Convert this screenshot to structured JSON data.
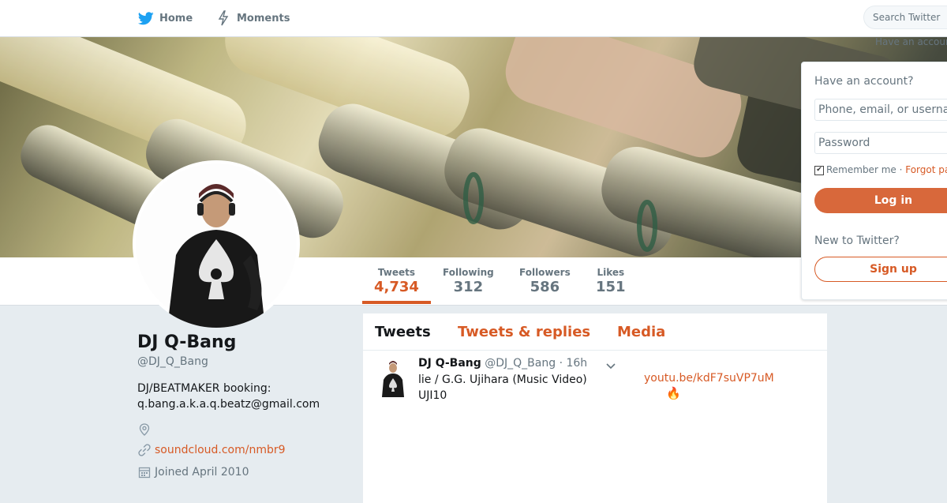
{
  "nav": {
    "home_label": "Home",
    "moments_label": "Moments",
    "search_placeholder": "Search Twitter",
    "have_account_small": "Have an account?"
  },
  "colors": {
    "accent": "#d75a25",
    "twitter_blue": "#1da1f2",
    "muted": "#66757f"
  },
  "profile": {
    "name": "DJ Q-Bang",
    "handle": "@DJ_Q_Bang",
    "bio_line1": "DJ/BEATMAKER booking:",
    "bio_line2": "q.bang.a.k.a.q.beatz@gmail.com",
    "website": "soundcloud.com/nmbr9",
    "joined": "Joined April 2010"
  },
  "stats": [
    {
      "label": "Tweets",
      "value": "4,734"
    },
    {
      "label": "Following",
      "value": "312"
    },
    {
      "label": "Followers",
      "value": "586"
    },
    {
      "label": "Likes",
      "value": "151"
    }
  ],
  "timeline": {
    "tabs": [
      "Tweets",
      "Tweets & replies",
      "Media"
    ],
    "tweet": {
      "name": "DJ Q-Bang",
      "handle": "@DJ_Q_Bang",
      "time": "· 16h",
      "text_line1": "lie / G.G. Ujihara (Music Video)",
      "text_line2": "UJI10",
      "link": "youtu.be/kdF7suVP7uM",
      "emoji": "🔥"
    }
  },
  "login": {
    "title": "Have an account?",
    "username_placeholder": "Phone, email, or username",
    "password_placeholder": "Password",
    "remember": "Remember me",
    "separator": " · ",
    "forgot": "Forgot password?",
    "login_button": "Log in",
    "new_to_twitter": "New to Twitter?",
    "signup_button": "Sign up"
  },
  "icons": [
    "twitter-bird-icon",
    "lightning-icon",
    "location-icon",
    "link-icon",
    "calendar-icon",
    "chevron-down-icon"
  ]
}
